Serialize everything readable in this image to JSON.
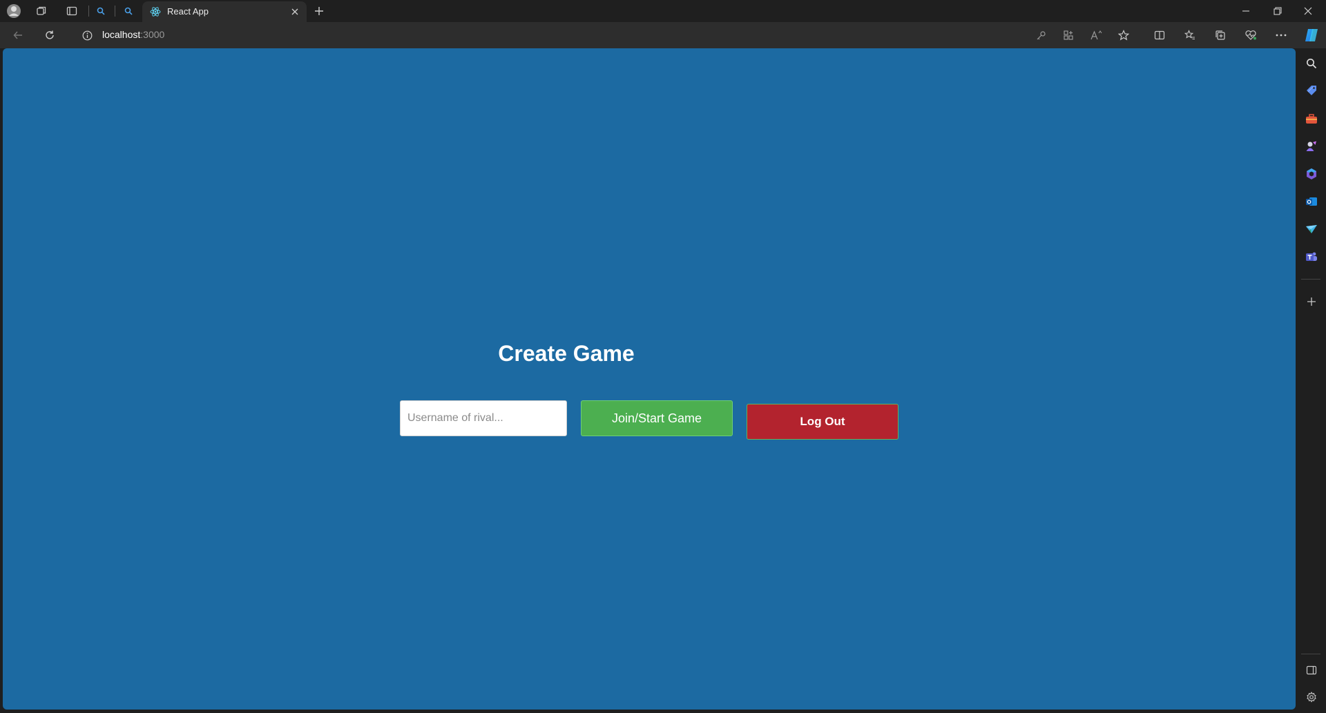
{
  "browser": {
    "tab": {
      "title": "React App"
    },
    "address": {
      "host": "localhost",
      "port": ":3000"
    }
  },
  "page": {
    "title": "Create Game",
    "rival_input": {
      "placeholder": "Username of rival...",
      "value": ""
    },
    "join_button_label": "Join/Start Game",
    "logout_button_label": "Log Out"
  },
  "colors": {
    "page_background": "#1c6aa2",
    "join_button": "#4caf50",
    "logout_button": "#b3232e",
    "browser_chrome": "#2d2d2d"
  },
  "icons": {
    "tabbar": [
      "profile-avatar-icon",
      "workspaces-icon",
      "tab-actions-icon",
      "search-tab-icon",
      "search-tab-icon",
      "react-logo-icon",
      "close-tab-icon",
      "new-tab-icon",
      "minimize-icon",
      "restore-icon",
      "close-window-icon"
    ],
    "toolbar": [
      "back-icon",
      "refresh-icon",
      "site-info-icon",
      "password-key-icon",
      "app-available-icon",
      "read-aloud-icon",
      "favorite-star-icon",
      "split-screen-icon",
      "favorites-icon",
      "collections-icon",
      "browser-essentials-icon",
      "more-icon",
      "copilot-icon"
    ],
    "sidebar": [
      "search-icon",
      "shopping-tag-icon",
      "tools-icon",
      "games-icon",
      "office-icon",
      "outlook-icon",
      "drop-icon",
      "teams-icon",
      "add-icon",
      "hide-sidebar-icon",
      "settings-icon"
    ]
  }
}
